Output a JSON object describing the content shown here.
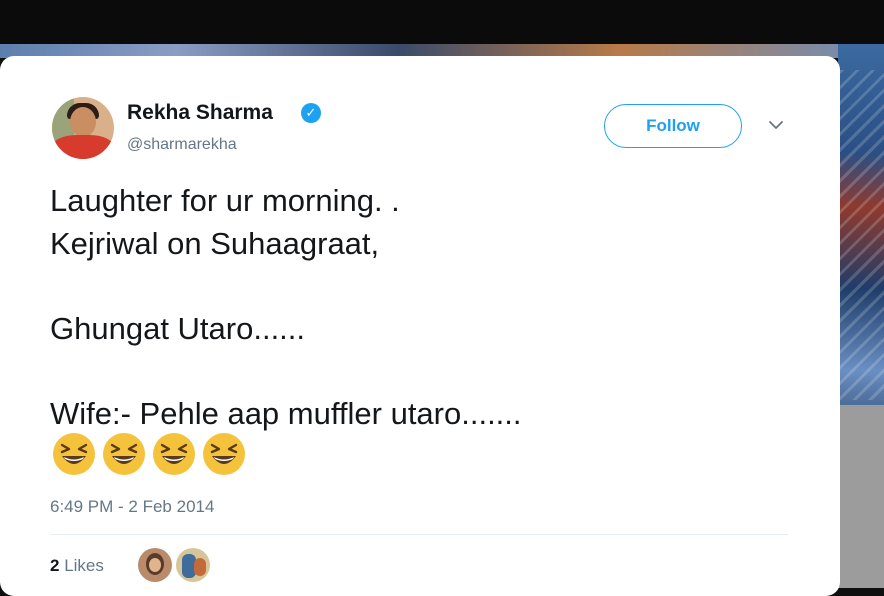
{
  "author": {
    "name": "Rekha Sharma",
    "handle": "@sharmarekha",
    "verified": true
  },
  "actions": {
    "follow_label": "Follow",
    "menu_icon": "chevron-down-icon"
  },
  "tweet": {
    "lines": [
      "Laughter for ur morning. .",
      "Kejriwal on Suhaagraat,",
      "Ghungat Utaro......",
      "Wife:- Pehle aap muffler utaro......."
    ],
    "emoji_icon": "laughing-face-icon",
    "emoji_count": 4,
    "timestamp": "6:49 PM - 2 Feb 2014"
  },
  "likes": {
    "count": "2",
    "label": "Likes"
  },
  "colors": {
    "accent": "#1da1f2",
    "text": "#14171a",
    "muted": "#657786",
    "emoji": "#f5c33b"
  }
}
